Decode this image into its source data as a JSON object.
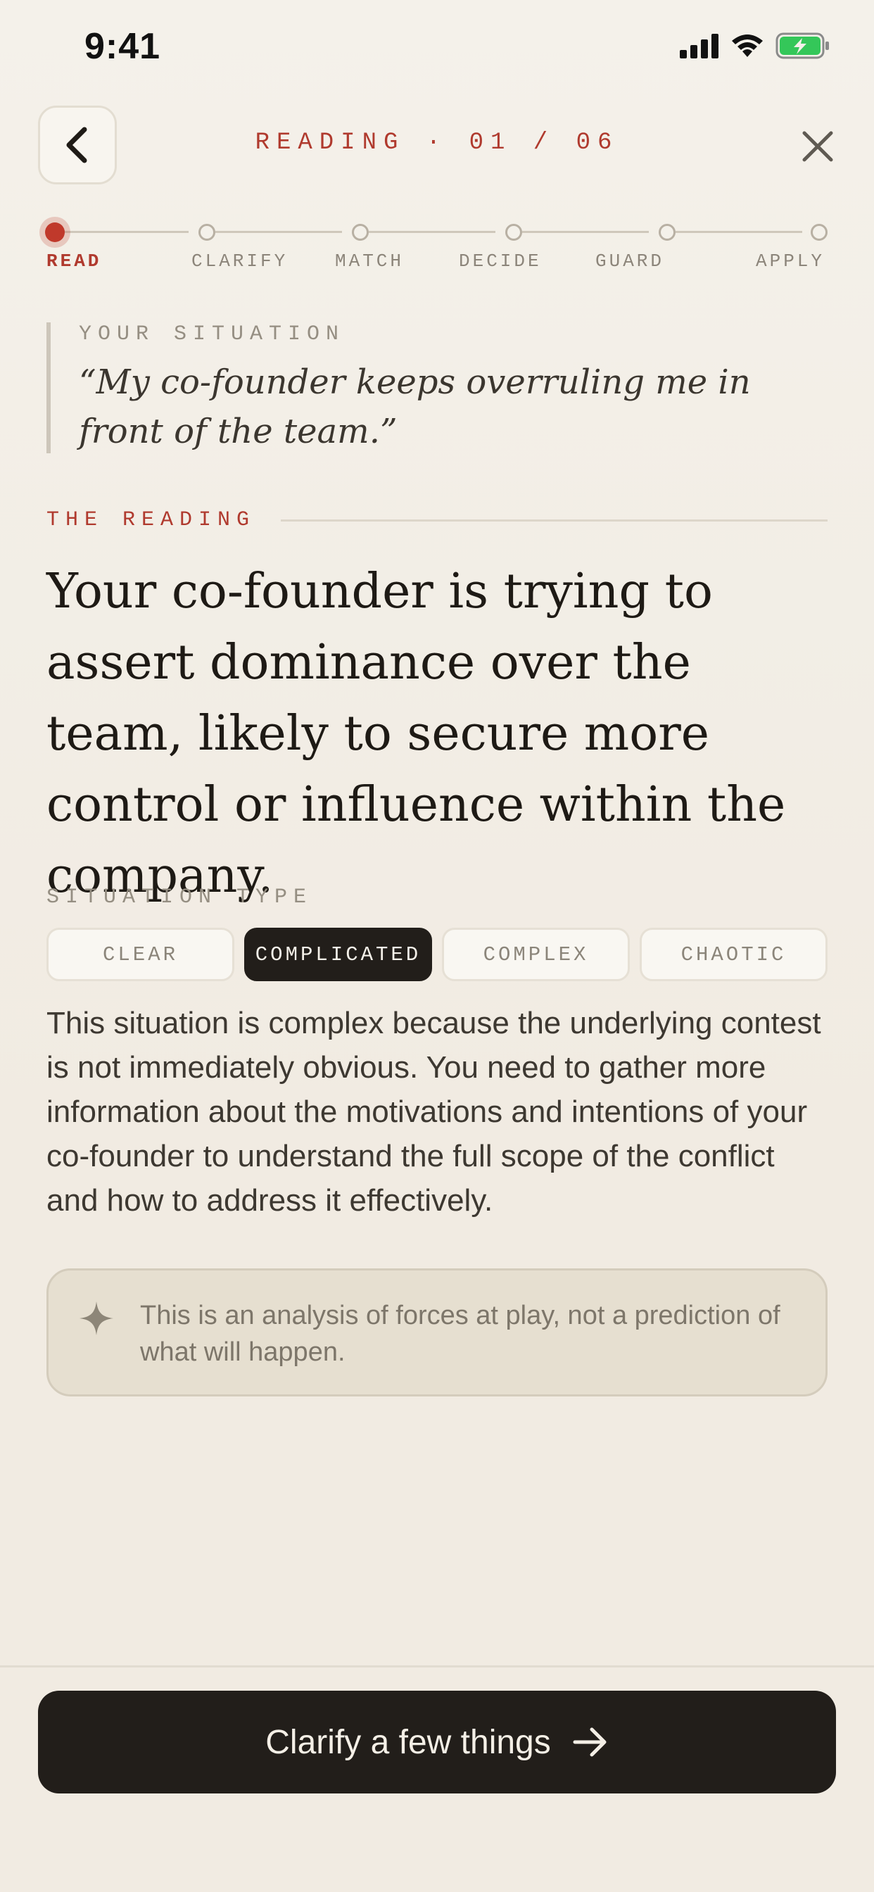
{
  "status_bar": {
    "time": "9:41"
  },
  "nav": {
    "title": "READING · 01 / 06"
  },
  "steps": [
    {
      "label": "READ",
      "active": true
    },
    {
      "label": "CLARIFY",
      "active": false
    },
    {
      "label": "MATCH",
      "active": false
    },
    {
      "label": "DECIDE",
      "active": false
    },
    {
      "label": "GUARD",
      "active": false
    },
    {
      "label": "APPLY",
      "active": false
    }
  ],
  "situation": {
    "kicker": "YOUR SITUATION",
    "quote": "“My co-founder keeps overruling me in front of the team.”"
  },
  "reading": {
    "kicker": "THE READING",
    "text": "Your co-founder is trying to assert dominance over the team, likely to secure more control or influence within the company."
  },
  "situation_type": {
    "kicker": "SITUATION TYPE",
    "options": [
      "CLEAR",
      "COMPLICATED",
      "COMPLEX",
      "CHAOTIC"
    ],
    "selected": "COMPLICATED",
    "description": "This situation is complex because the underlying contest is not immediately obvious. You need to gather more information about the motivations and intentions of your co-founder to understand the full scope of the conflict and how to address it effectively."
  },
  "note": {
    "icon": "sparkle-icon",
    "text": "This is an analysis of forces at play, not a prediction of what will happen."
  },
  "cta": {
    "label": "Clarify a few things",
    "icon": "arrow-right-icon"
  },
  "colors": {
    "accent": "#b03a2e",
    "ink": "#221e1a",
    "background": "#f1ebe2",
    "battery": "#34c759"
  }
}
